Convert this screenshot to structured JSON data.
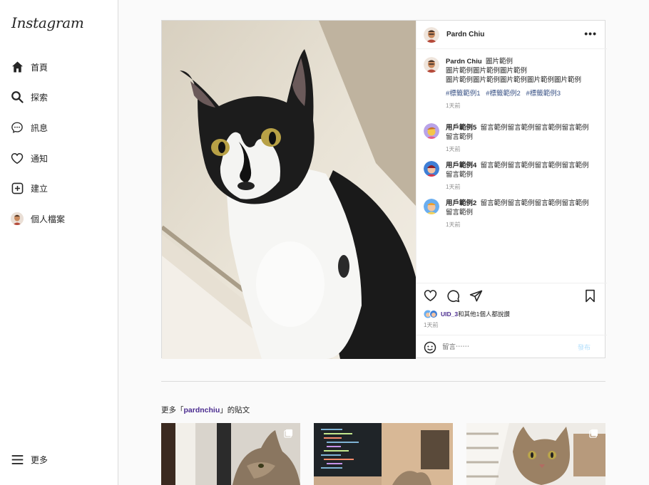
{
  "brand": {
    "logo": "Instagram"
  },
  "sidebar": {
    "items": [
      {
        "label": "首頁",
        "icon": "home-icon"
      },
      {
        "label": "探索",
        "icon": "search-icon"
      },
      {
        "label": "訊息",
        "icon": "messenger-icon"
      },
      {
        "label": "通知",
        "icon": "heart-icon"
      },
      {
        "label": "建立",
        "icon": "plus-square-icon"
      },
      {
        "label": "個人檔案",
        "icon": "avatar-icon"
      }
    ],
    "more_label": "更多"
  },
  "post": {
    "username": "Pardn Chiu",
    "caption": {
      "username": "Pardn Chiu",
      "text": "圖片範例",
      "line2": "圖片範例圖片範例圖片範例",
      "line3": "圖片範例圖片範例圖片範例圖片範例圖片範例",
      "tags": [
        "#標籤範例1",
        "#標籤範例2",
        "#標籤範例3"
      ],
      "time": "1天前"
    },
    "comments": [
      {
        "user": "用戶範例5",
        "text": "留言範例留言範例留言範例留言範例留言範例",
        "time": "1天前"
      },
      {
        "user": "用戶範例4",
        "text": "留言範例留言範例留言範例留言範例留言範例",
        "time": "1天前"
      },
      {
        "user": "用戶範例2",
        "text": "留言範例留言範例留言範例留言範例留言範例",
        "time": "1天前"
      }
    ],
    "likes": {
      "uid": "UID_3",
      "rest": "和其他1個人都說讚"
    },
    "likes_time": "1天前",
    "comment_placeholder": "留言⋯⋯",
    "post_button": "發布"
  },
  "more_posts": {
    "prefix": "更多「",
    "account": "pardnchiu",
    "suffix": "」的貼文"
  },
  "colors": {
    "link": "#385185",
    "accent_user": "#4a2b8f",
    "post_btn": "#b2dffc"
  }
}
